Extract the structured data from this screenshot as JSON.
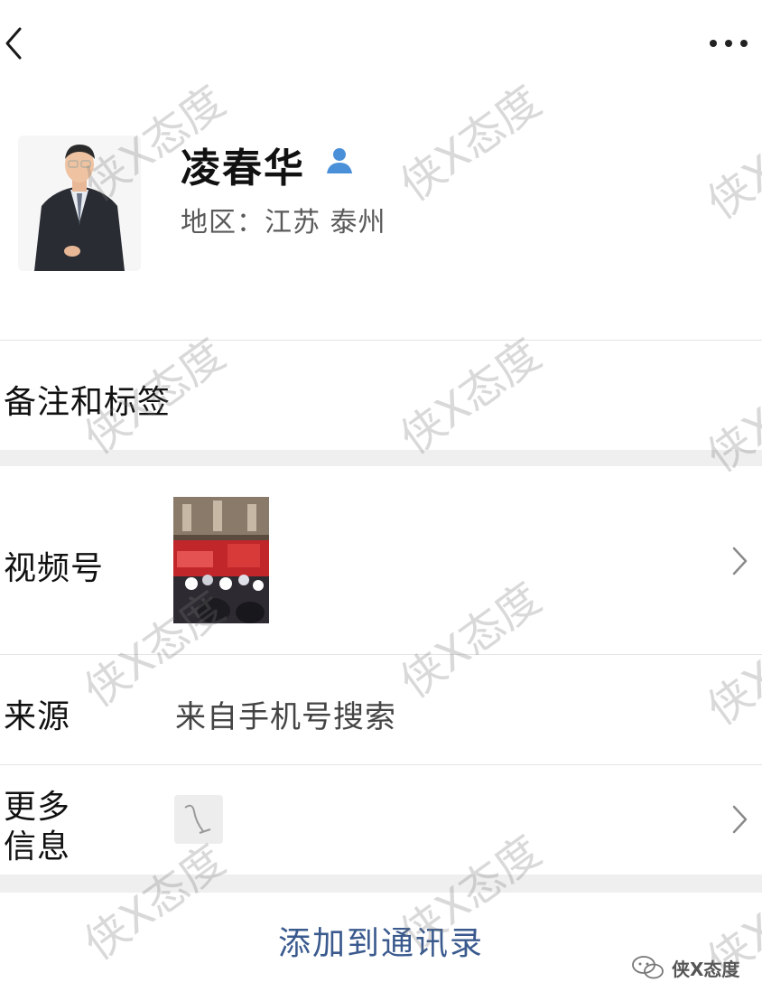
{
  "header": {
    "back_icon": "chevron-left-icon",
    "more_icon": "more-dots-icon"
  },
  "profile": {
    "name": "凌春华",
    "badge_icon": "person-icon",
    "region": "地区：江苏 泰州"
  },
  "rows": {
    "remarks_label": "备注和标签",
    "channels_label": "视频号",
    "source_label": "来源",
    "source_value": "来自手机号搜索",
    "more_info_label_line1": "更多",
    "more_info_label_line2": "信息"
  },
  "actions": {
    "add_contact": "添加到通讯录"
  },
  "watermark": {
    "text": "侠X态度",
    "corner_text": "侠X态度"
  },
  "colors": {
    "accent": "#3a5a8e",
    "badge": "#4a90d9",
    "gap": "#efefef"
  }
}
